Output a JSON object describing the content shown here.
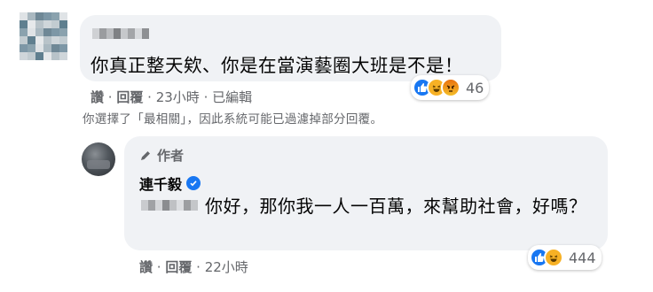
{
  "comment": {
    "text": "你真正整天欸、你是在當演藝圈大班是不是！",
    "actions": {
      "like": "讚",
      "reply": "回覆",
      "time": "23小時",
      "edited": "已編輯"
    },
    "reaction_count": "46",
    "reactions": [
      "like",
      "haha",
      "angry"
    ]
  },
  "filter_notice": "你選擇了「最相關」，因此系統可能已過濾掉部分回覆。",
  "reply": {
    "author_badge": "作者",
    "name": "連千毅",
    "text": "你好，那你我一人一百萬，來幫助社會，好嗎？",
    "actions": {
      "like": "讚",
      "reply": "回覆",
      "time": "22小時"
    },
    "reaction_count": "444",
    "reactions": [
      "like",
      "haha"
    ]
  },
  "colors": {
    "accent": "#1877f2",
    "bubble": "#f0f2f5",
    "meta": "#65676b"
  }
}
